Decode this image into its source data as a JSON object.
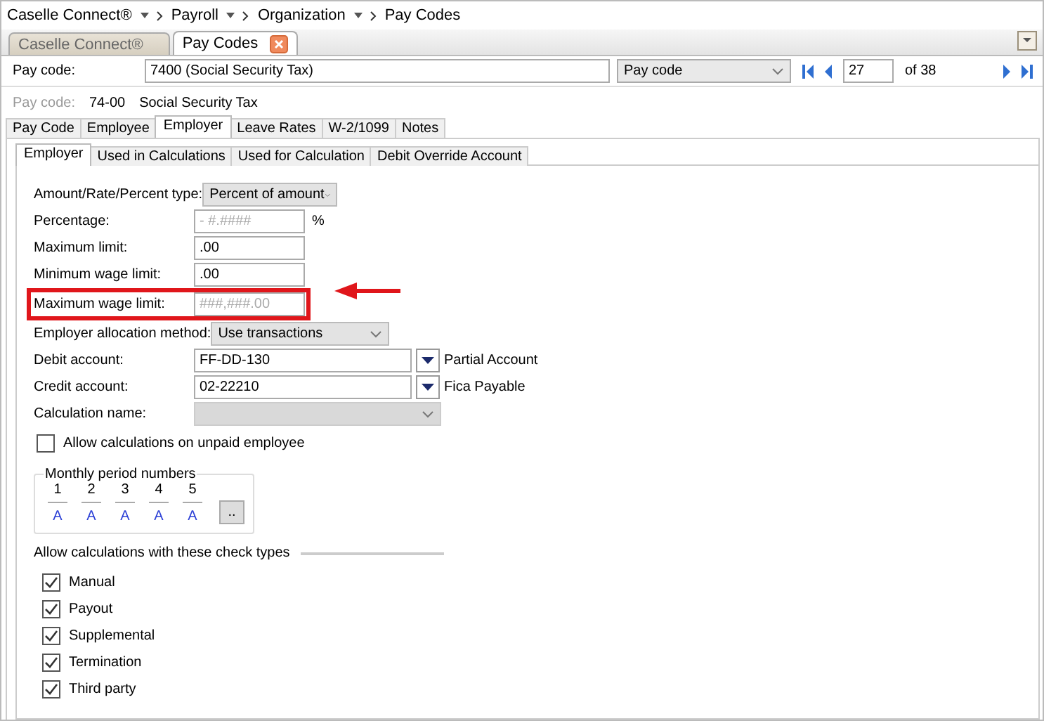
{
  "breadcrumb": [
    {
      "label": "Caselle Connect®",
      "has_menu": true
    },
    {
      "label": "Payroll",
      "has_menu": true
    },
    {
      "label": "Organization",
      "has_menu": true
    },
    {
      "label": "Pay Codes",
      "has_menu": false
    }
  ],
  "document_tabs": [
    {
      "label": "Caselle Connect®",
      "selected": false,
      "closable": false
    },
    {
      "label": "Pay Codes",
      "selected": true,
      "closable": true
    }
  ],
  "record_bar": {
    "label": "Pay code:",
    "value": "7400 (Social Security Tax)",
    "lookup_by": "Pay code",
    "record": "27",
    "record_count": "of 38"
  },
  "summary": {
    "label": "Pay code:",
    "code": "74-00",
    "name": "Social Security Tax"
  },
  "tabs": [
    {
      "label": "Pay Code",
      "selected": false
    },
    {
      "label": "Employee",
      "selected": false
    },
    {
      "label": "Employer",
      "selected": true
    },
    {
      "label": "Leave Rates",
      "selected": false
    },
    {
      "label": "W-2/1099",
      "selected": false
    },
    {
      "label": "Notes",
      "selected": false
    }
  ],
  "subtabs": [
    {
      "label": "Employer",
      "selected": true
    },
    {
      "label": "Used in Calculations",
      "selected": false
    },
    {
      "label": "Used for Calculation",
      "selected": false
    },
    {
      "label": "Debit Override Account",
      "selected": false
    }
  ],
  "fields": [
    {
      "kind": "select",
      "label": "Amount/Rate/Percent type:",
      "value": "Percent of amount",
      "disabled": false,
      "highlighted": false
    },
    {
      "kind": "input",
      "label": "Percentage:",
      "placeholder": "- #.####",
      "suffix": "%",
      "highlighted": false
    },
    {
      "kind": "input",
      "label": "Maximum limit:",
      "value": ".00",
      "highlighted": false
    },
    {
      "kind": "input",
      "label": "Minimum wage limit:",
      "value": ".00",
      "highlighted": false
    },
    {
      "kind": "input",
      "label": "Maximum wage limit:",
      "placeholder": "###,###.00",
      "highlighted": true
    },
    {
      "kind": "select",
      "label": "Employer allocation method:",
      "value": "Use transactions",
      "disabled": false,
      "highlighted": false
    },
    {
      "kind": "account",
      "label": "Debit account:",
      "value": "FF-DD-130",
      "description": "Partial Account",
      "highlighted": false
    },
    {
      "kind": "account",
      "label": "Credit account:",
      "value": "02-22210",
      "description": "Fica Payable",
      "highlighted": false
    },
    {
      "kind": "select",
      "label": "Calculation name:",
      "disabled": true,
      "highlighted": false
    }
  ],
  "unpaid_option": {
    "label": "Allow calculations on unpaid employee",
    "checked": false
  },
  "monthly_periods": {
    "title": "Monthly period numbers",
    "periods": [
      {
        "number": "1",
        "value": "A"
      },
      {
        "number": "2",
        "value": "A"
      },
      {
        "number": "3",
        "value": "A"
      },
      {
        "number": "4",
        "value": "A"
      },
      {
        "number": "5",
        "value": "A"
      }
    ],
    "more_button": ".."
  },
  "check_types": {
    "title": "Allow calculations with these check types",
    "items": [
      {
        "label": "Manual",
        "checked": true
      },
      {
        "label": "Payout",
        "checked": true
      },
      {
        "label": "Supplemental",
        "checked": true
      },
      {
        "label": "Termination",
        "checked": true
      },
      {
        "label": "Third party",
        "checked": true
      }
    ]
  }
}
